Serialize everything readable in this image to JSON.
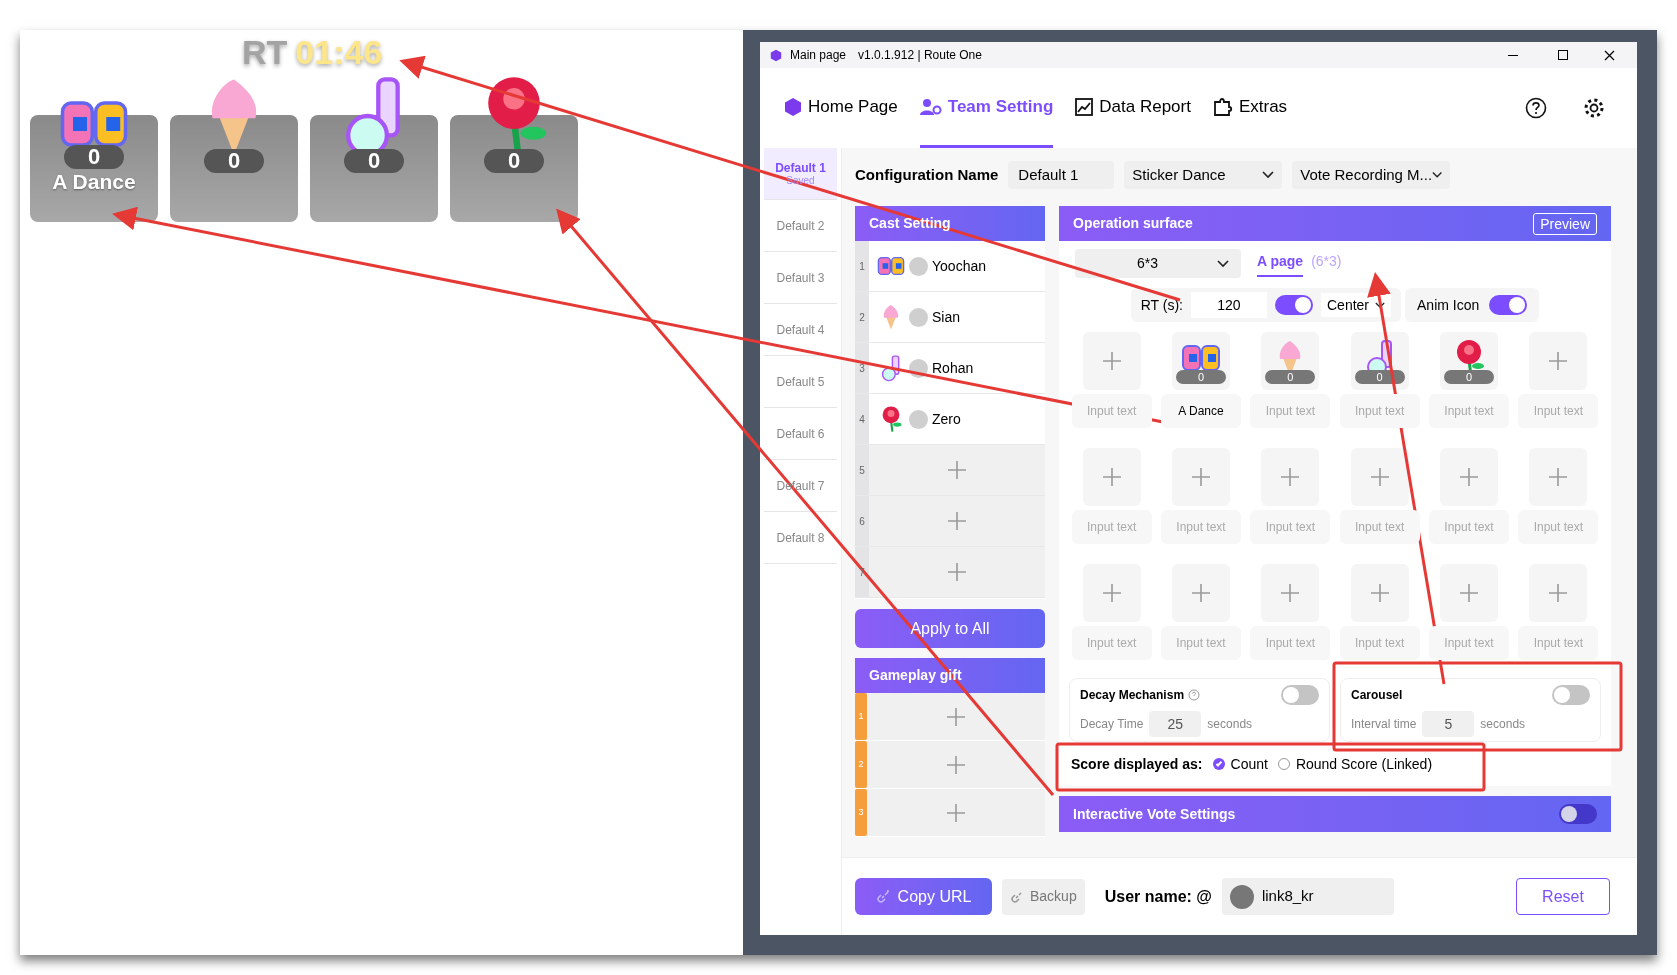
{
  "preview": {
    "timer_label": "RT",
    "timer": "01:46",
    "cards": [
      {
        "kind": "lettering",
        "count": "0",
        "name": "A Dance"
      },
      {
        "kind": "ice_cream",
        "count": "0"
      },
      {
        "kind": "music_note",
        "count": "0"
      },
      {
        "kind": "rose",
        "count": "0"
      }
    ]
  },
  "window": {
    "title": "Main page",
    "version": "v1.0.1.912 | Route One"
  },
  "nav": [
    {
      "label": "Home Page",
      "selected": false
    },
    {
      "label": "Team Setting",
      "selected": true
    },
    {
      "label": "Data Report",
      "selected": false
    },
    {
      "label": "Extras",
      "selected": false
    }
  ],
  "configs": [
    {
      "label": "Default 1",
      "status": "Saved",
      "selected": true
    },
    {
      "label": "Default 2",
      "selected": false
    },
    {
      "label": "Default 3",
      "selected": false
    },
    {
      "label": "Default 4",
      "selected": false
    },
    {
      "label": "Default 5",
      "selected": false
    },
    {
      "label": "Default 6",
      "selected": false
    },
    {
      "label": "Default 7",
      "selected": false
    },
    {
      "label": "Default 8",
      "selected": false
    }
  ],
  "config_name": {
    "label": "Configuration Name",
    "value": "Default 1",
    "dropdowns": [
      "Sticker Dance",
      "Vote Recording M..."
    ]
  },
  "cast": {
    "title": "Cast Setting",
    "rows": [
      {
        "index": "1",
        "kind": "lettering",
        "name": "Yoochan"
      },
      {
        "index": "2",
        "kind": "ice_cream",
        "name": "Sian"
      },
      {
        "index": "3",
        "kind": "music_note",
        "name": "Rohan"
      },
      {
        "index": "4",
        "kind": "rose",
        "name": "Zero"
      },
      {
        "index": "5"
      },
      {
        "index": "6"
      },
      {
        "index": "7"
      }
    ],
    "apply_button": "Apply to All"
  },
  "gameplay_gift": {
    "title": "Gameplay gift",
    "rows": [
      {
        "index": "1"
      },
      {
        "index": "2"
      },
      {
        "index": "3"
      }
    ]
  },
  "operation": {
    "title": "Operation surface",
    "preview_button": "Preview",
    "layout": "6*3",
    "page_tab": {
      "label": "A page",
      "detail": "(6*3)",
      "selected": true
    },
    "rt_label": "RT (s):",
    "rt_value": "120",
    "rt_on": true,
    "align": "Center",
    "anim_label": "Anim Icon",
    "anim_on": true,
    "slots": [
      {
        "placeholder": "Input text"
      },
      {
        "kind": "lettering",
        "count": "0",
        "value": "A Dance"
      },
      {
        "kind": "ice_cream",
        "count": "0",
        "placeholder": "Input text"
      },
      {
        "kind": "music_note",
        "count": "0",
        "placeholder": "Input text"
      },
      {
        "kind": "rose",
        "count": "0",
        "placeholder": "Input text"
      },
      {
        "placeholder": "Input text"
      },
      {
        "placeholder": "Input text"
      },
      {
        "placeholder": "Input text"
      },
      {
        "placeholder": "Input text"
      },
      {
        "placeholder": "Input text"
      },
      {
        "placeholder": "Input text"
      },
      {
        "placeholder": "Input text"
      },
      {
        "placeholder": "Input text"
      },
      {
        "placeholder": "Input text"
      },
      {
        "placeholder": "Input text"
      },
      {
        "placeholder": "Input text"
      },
      {
        "placeholder": "Input text"
      },
      {
        "placeholder": "Input text"
      }
    ],
    "decay": {
      "title": "Decay Mechanism",
      "on": false,
      "label": "Decay Time",
      "value": "25",
      "unit": "seconds"
    },
    "carousel": {
      "title": "Carousel",
      "on": false,
      "label": "Interval time",
      "value": "5",
      "unit": "seconds"
    },
    "score": {
      "label": "Score displayed as:",
      "options": [
        {
          "label": "Count",
          "selected": true
        },
        {
          "label": "Round Score (Linked)",
          "selected": false
        }
      ]
    },
    "vote": {
      "title": "Interactive Vote Settings",
      "on": false
    }
  },
  "bottom": {
    "copy_button": "Copy URL",
    "backup_button": "Backup",
    "user_label": "User name: @",
    "user_value": "link8_kr",
    "reset_button": "Reset"
  }
}
